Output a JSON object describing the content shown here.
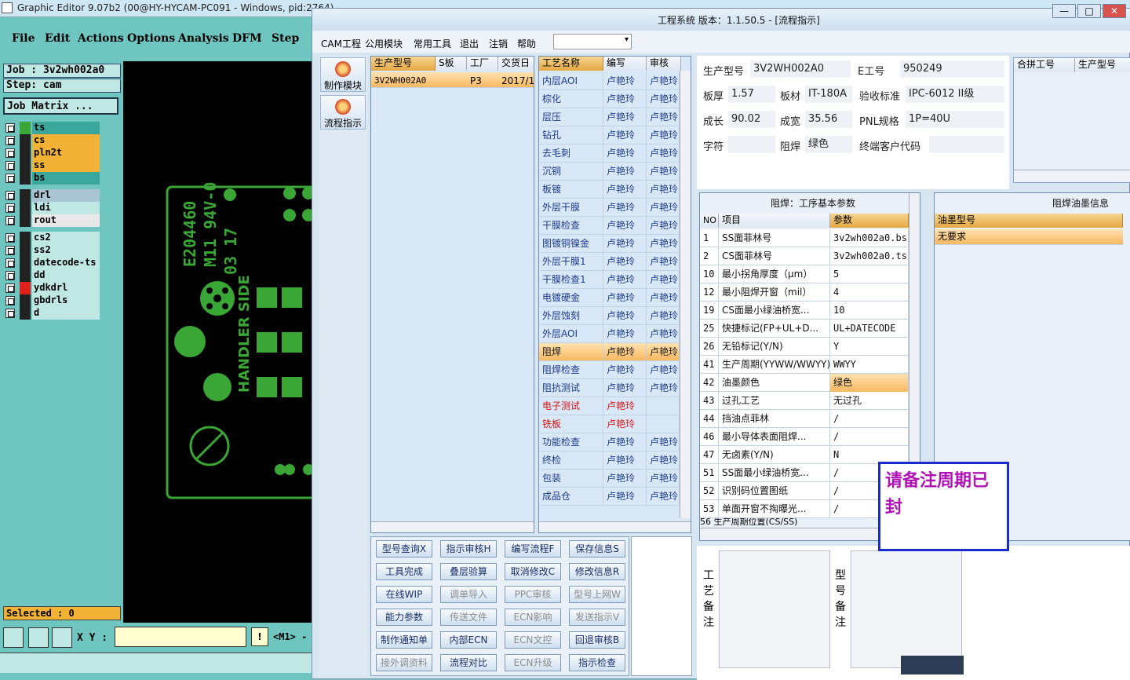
{
  "ge": {
    "title": "Graphic Editor 9.07b2 (00@HY-HYCAM-PC091 - Windows, pid:2764)",
    "menu": [
      "File",
      "Edit",
      "Actions",
      "Options",
      "Analysis",
      "DFM",
      "Step"
    ],
    "job": "Job : 3v2wh002a0",
    "step": "Step: cam",
    "matrix": "Job Matrix ...",
    "layers": [
      {
        "name": "ts",
        "swatch": "#3aa635",
        "bg": "#3aa69c"
      },
      {
        "name": "cs",
        "swatch": "#222",
        "bg": "#f1b236"
      },
      {
        "name": "pln2t",
        "swatch": "#222",
        "bg": "#f1b236"
      },
      {
        "name": "ss",
        "swatch": "#222",
        "bg": "#f1b236"
      },
      {
        "name": "bs",
        "swatch": "#222",
        "bg": "#3aa69c"
      },
      {
        "name": "drl",
        "swatch": "#222",
        "bg": "#a9c4d2"
      },
      {
        "name": "ldi",
        "swatch": "#222",
        "bg": "#bfe8e4"
      },
      {
        "name": "rout",
        "swatch": "#222",
        "bg": "#e8e8e8"
      },
      {
        "name": "cs2",
        "swatch": "#222",
        "bg": "#bfe8e4"
      },
      {
        "name": "ss2",
        "swatch": "#222",
        "bg": "#bfe8e4"
      },
      {
        "name": "datecode-ts",
        "swatch": "#222",
        "bg": "#bfe8e4"
      },
      {
        "name": "dd",
        "swatch": "#222",
        "bg": "#bfe8e4"
      },
      {
        "name": "ydkdrl",
        "swatch": "#e0201c",
        "bg": "#bfe8e4"
      },
      {
        "name": "gbdrls",
        "swatch": "#222",
        "bg": "#bfe8e4"
      },
      {
        "name": "d",
        "swatch": "#222",
        "bg": "#bfe8e4"
      }
    ],
    "selected": "Selected : 0",
    "xy_label": "X Y :",
    "info_btn": "!",
    "m1": "<M1> -",
    "canvas_texts": {
      "code": "E204460",
      "rating": "M11 94V-0",
      "date": "03 17",
      "side": "HANDLER SIDE"
    }
  },
  "mes": {
    "title": "工程系统   版本：1.1.50.5 - [流程指示]",
    "win_controls": [
      "—",
      "□",
      "✕"
    ],
    "menu": [
      "CAM工程",
      "公用模块",
      "常用工具",
      "退出",
      "注销",
      "帮助"
    ],
    "modules": [
      "制作模块",
      "流程指示"
    ],
    "orders": {
      "headers": [
        "生产型号",
        "S板",
        "工厂",
        "交货日"
      ],
      "rows": [
        [
          "3V2WH002A0",
          "",
          "P3",
          "2017/1"
        ]
      ]
    },
    "process": {
      "headers": [
        "工艺名称",
        "编写",
        "审核"
      ],
      "rows": [
        [
          "内层AOI",
          "卢艳玲",
          "卢艳玲"
        ],
        [
          "棕化",
          "卢艳玲",
          "卢艳玲"
        ],
        [
          "层压",
          "卢艳玲",
          "卢艳玲"
        ],
        [
          "钻孔",
          "卢艳玲",
          "卢艳玲"
        ],
        [
          "去毛刺",
          "卢艳玲",
          "卢艳玲"
        ],
        [
          "沉铜",
          "卢艳玲",
          "卢艳玲"
        ],
        [
          "板镀",
          "卢艳玲",
          "卢艳玲"
        ],
        [
          "外层干膜",
          "卢艳玲",
          "卢艳玲"
        ],
        [
          "干膜检查",
          "卢艳玲",
          "卢艳玲"
        ],
        [
          "图镀铜镍金",
          "卢艳玲",
          "卢艳玲"
        ],
        [
          "外层干膜1",
          "卢艳玲",
          "卢艳玲"
        ],
        [
          "干膜检查1",
          "卢艳玲",
          "卢艳玲"
        ],
        [
          "电镀硬金",
          "卢艳玲",
          "卢艳玲"
        ],
        [
          "外层蚀刻",
          "卢艳玲",
          "卢艳玲"
        ],
        [
          "外层AOI",
          "卢艳玲",
          "卢艳玲"
        ],
        [
          "阻焊",
          "卢艳玲",
          "卢艳玲"
        ],
        [
          "阻焊检查",
          "卢艳玲",
          "卢艳玲"
        ],
        [
          "阻抗测试",
          "卢艳玲",
          "卢艳玲"
        ],
        [
          "电子测试",
          "卢艳玲",
          ""
        ],
        [
          "铣板",
          "卢艳玲",
          ""
        ],
        [
          "功能检查",
          "卢艳玲",
          "卢艳玲"
        ],
        [
          "终检",
          "卢艳玲",
          "卢艳玲"
        ],
        [
          "包装",
          "卢艳玲",
          "卢艳玲"
        ],
        [
          "成品仓",
          "卢艳玲",
          "卢艳玲"
        ]
      ],
      "selected_index": 15,
      "red_indices": [
        18,
        19
      ]
    },
    "info": {
      "model_label": "生产型号",
      "model": "3V2WH002A0",
      "eng_label": "E工号",
      "eng": "950249",
      "thick_label": "板厚",
      "thick": "1.57",
      "mat_label": "板材",
      "mat": "IT-180A",
      "std_label": "验收标准",
      "std": "IPC-6012 II级",
      "len_label": "成长",
      "len": "90.02",
      "wid_label": "成宽",
      "wid": "35.56",
      "pnl_label": "PNL规格",
      "pnl": "1P=40U",
      "char_label": "字符",
      "char": "",
      "sm_label": "阻焊",
      "sm": "绿色",
      "cust_label": "终端客户代码",
      "cust": ""
    },
    "combine_headers": [
      "合拼工号",
      "生产型号"
    ],
    "params": {
      "title": "阻焊：工序基本参数",
      "headers": [
        "NO",
        "项目",
        "参数"
      ],
      "rows": [
        [
          "1",
          "SS面菲林号",
          "3v2wh002a0.bs"
        ],
        [
          "2",
          "CS面菲林号",
          "3v2wh002a0.ts"
        ],
        [
          "10",
          "最小拐角厚度（μm）",
          "5"
        ],
        [
          "12",
          "最小阻焊开窗（mil）",
          "4"
        ],
        [
          "19",
          "CS面最小绿油桥宽...",
          "10"
        ],
        [
          "25",
          "快捷标记(FP+UL+D...",
          "UL+DATECODE"
        ],
        [
          "26",
          "无铅标记(Y/N)",
          "Y"
        ],
        [
          "41",
          "生产周期(YYWW/WWYY)",
          "WWYY"
        ],
        [
          "42",
          "油墨颜色",
          "绿色"
        ],
        [
          "43",
          "过孔工艺",
          "无过孔"
        ],
        [
          "44",
          "挡油点菲林",
          "/"
        ],
        [
          "46",
          "最小导体表面阻焊...",
          "/"
        ],
        [
          "47",
          "无卤素(Y/N)",
          "N"
        ],
        [
          "51",
          "SS面最小绿油桥宽...",
          "/"
        ],
        [
          "52",
          "识别码位置图纸",
          "/"
        ],
        [
          "53",
          "单面开窗不掏曝光...",
          "/"
        ]
      ],
      "highlight_index": 8,
      "partial_row": "56  生产周期位置(CS/SS)"
    },
    "ink": {
      "title": "阻焊油墨信息",
      "header": "油墨型号",
      "value": "无要求"
    },
    "buttons": [
      [
        "型号查询X",
        "指示审核H",
        "编写流程F",
        "保存信息S"
      ],
      [
        "工具完成",
        "叠层验算",
        "取消修改C",
        "修改信息R"
      ],
      [
        "在线WIP",
        "调单导入",
        "PPC审核",
        "型号上网W"
      ],
      [
        "能力参数",
        "传送文件",
        "ECN影响",
        "发送指示V"
      ],
      [
        "制作通知单",
        "内部ECN",
        "ECN文控",
        "回退审核B"
      ],
      [
        "接外调资料",
        "流程对比",
        "ECN升级",
        "指示检查"
      ]
    ],
    "disabled_buttons": [
      "调单导入",
      "PPC审核",
      "型号上网W",
      "传送文件",
      "ECN影响",
      "发送指示V",
      "ECN文控",
      "ECN升级",
      "接外调资料"
    ],
    "memo1_label": "工艺备注",
    "memo2_label": "型号备注",
    "notice": "请备注周期已封"
  }
}
